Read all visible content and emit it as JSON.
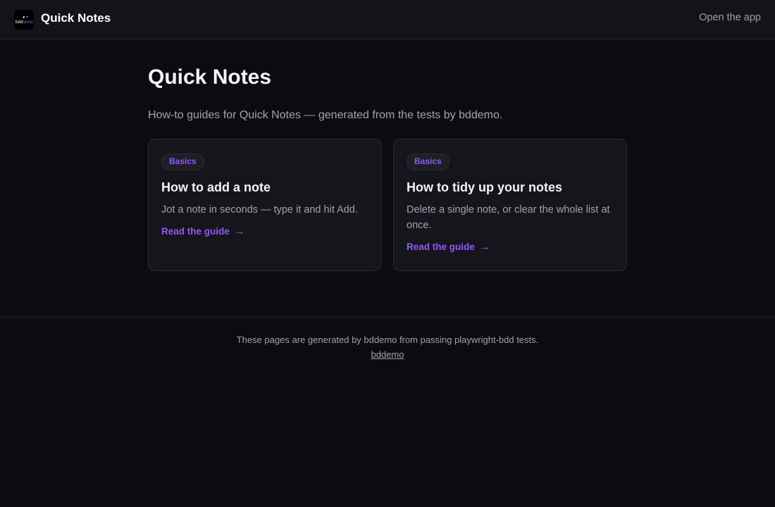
{
  "header": {
    "logo_text": "bddemo",
    "app_name": "Quick Notes",
    "open_app_label": "Open the app"
  },
  "main": {
    "title": "Quick Notes",
    "subtitle": "How-to guides for Quick Notes — generated from the tests by bddemo.",
    "cards": [
      {
        "badge": "Basics",
        "title": "How to add a note",
        "description": "Jot a note in seconds — type it and hit Add.",
        "link_label": "Read the guide",
        "link_arrow": "→"
      },
      {
        "badge": "Basics",
        "title": "How to tidy up your notes",
        "description": "Delete a single note, or clear the whole list at once.",
        "link_label": "Read the guide",
        "link_arrow": "→"
      }
    ]
  },
  "footer": {
    "text": "These pages are generated by bddemo from passing playwright-bdd tests.",
    "link_label": "bddemo"
  },
  "colors": {
    "background": "#0c0b10",
    "accent": "#8b5cf6",
    "card_background": "#16151b"
  }
}
